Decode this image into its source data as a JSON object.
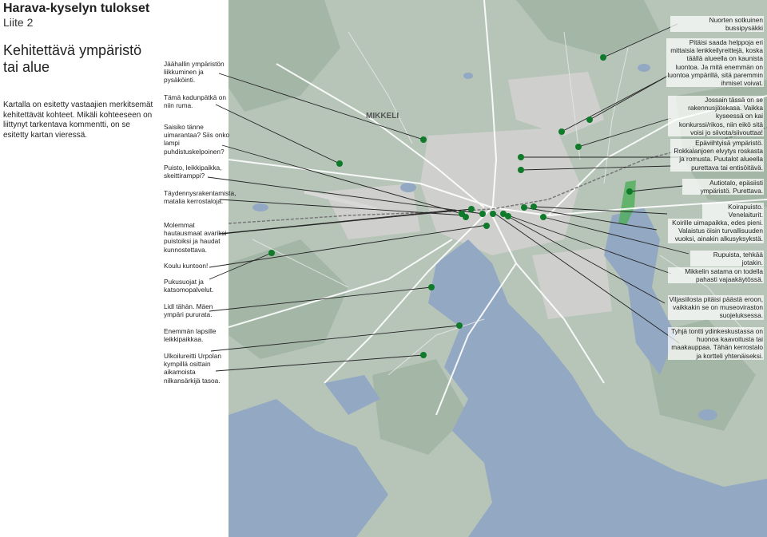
{
  "header": {
    "title": "Harava-kyselyn tulokset",
    "subtitle": "Liite 2"
  },
  "sidebar": {
    "heading_line1": "Kehitettävä ympäristö",
    "heading_line2": "tai alue",
    "intro": "Kartalla on esitetty vastaajien merkitsemät kehitettävät kohteet. Mikäli kohteeseen on liittynyt tarkentava kommentti, on se esitetty kartan vieressä."
  },
  "map": {
    "city_label": "MIKKELI",
    "colors": {
      "land": "#b7c5b9",
      "forest": "#a3b5a6",
      "water": "#93a9c3",
      "urban": "#cfcfcd",
      "road": "#ffffff",
      "marker": "#0f7a2a",
      "highlight": "#4fae5a",
      "leader_line": "#222222"
    },
    "marker_icon": "green-dot"
  },
  "comments_left": [
    "Jäähallin ympäristön liikkuminen ja pysäköinti.",
    "Tämä kadunpätkä on niin ruma.",
    "Saisiko tänne uimarantaa? Siis onko lampi puhdistuskelpoinen?",
    "Puisto, leikkipaikka, skeittiramppi?",
    "Täydennysrakentamista, matalia kerrostaloja.",
    "Molemmat hautausmaat avariksi puistoiksi ja haudat kunnostettava.",
    "Koulu kuntoon!",
    "Pukusuojat ja katsomopalvelut.",
    "Lidl tähän. Mäen ympäri pururata.",
    "Enemmän lapsille leikkipaikkaa.",
    "Ulkoilureitti Urpolan kympillä osittain aikamoista nilkansärkijä tasoa."
  ],
  "comments_right": [
    "Nuorten sotkuinen bussipysäkki",
    "Pitäisi saada helppoja eri mittaisia lenkkeilyreittejä, koska täällä alueella on kaunista luontoa. Ja mitä enemmän on luontoa ympärillä, sitä paremmin ihmiset voivat.",
    "Jossain tässä on se rakennusjätekasa. Vaikka kyseessä on kai konkurssi/rikos, niin eikö sitä voisi jo siivota/siivouttaa!",
    "Epäviihtyisä ympäristö. Rokkalanjoen elvytys roskasta ja romusta. Puutalot alueella purettava tai entisöitävä.",
    "Autiotalo, epäsiisti ympäristö. Purettava.",
    "Koirapuisto. Venelaiturit.",
    "Koirille uimapaikka, edes pieni. Valaistus öisin turvallisuuden vuoksi, ainakin alkusyksykstä.",
    "Rupuista, tehkää jotakin.",
    "Mikkelin satama on todella pahasti vajaakäytössä.",
    "Viljasiilosta pitäisi päästä eroon, vaikkakin se on museoviraston suojeluksessa.",
    "Tyhjä tontti ydinkeskustassa on huonoa kaavoitusta tai maakauppaa. Tähän kerrostalo ja kortteli yhtenäiseksi."
  ]
}
